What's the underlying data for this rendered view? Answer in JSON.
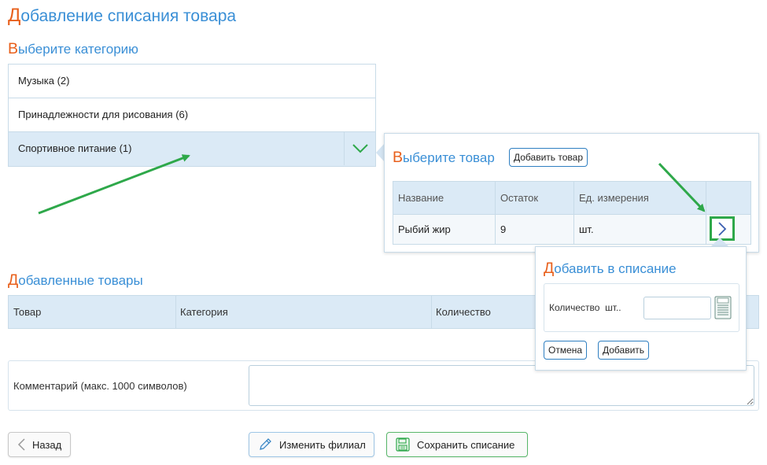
{
  "page": {
    "title_first": "Д",
    "title_rest": "обавление списания товара"
  },
  "category_section": {
    "heading_first": "В",
    "heading_rest": "ыберите категорию",
    "items": [
      {
        "label": "Музыка (2)"
      },
      {
        "label": "Принадлежности для рисования (6)"
      },
      {
        "label": "Спортивное питание (1)"
      }
    ],
    "selected_index": 2
  },
  "product_popup": {
    "heading_first": "В",
    "heading_rest": "ыберите товар",
    "add_product_button": "Добавить товар",
    "columns": [
      "Название",
      "Остаток",
      "Ед. измерения"
    ],
    "rows": [
      {
        "name": "Рыбий жир",
        "stock": "9",
        "unit": "шт."
      }
    ]
  },
  "add_popup": {
    "heading_first": "Д",
    "heading_rest": "обавить в списание",
    "quantity_label": "Количество  шт..",
    "quantity_value": "",
    "cancel_button": "Отмена",
    "add_button": "Добавить"
  },
  "added_section": {
    "heading_first": "Д",
    "heading_rest": "обавленные товары",
    "columns": [
      "Товар",
      "Категория",
      "Количество"
    ]
  },
  "comment": {
    "label": "Комментарий (макс. 1000 символов)",
    "value": ""
  },
  "footer": {
    "back_button": "Назад",
    "change_branch_button": "Изменить филиал",
    "save_button": "Сохранить списание"
  },
  "colors": {
    "accent_blue": "#3a8fd6",
    "accent_orange": "#e8601c",
    "highlight_green": "#2ea84a",
    "row_selected": "#dbeaf6"
  }
}
